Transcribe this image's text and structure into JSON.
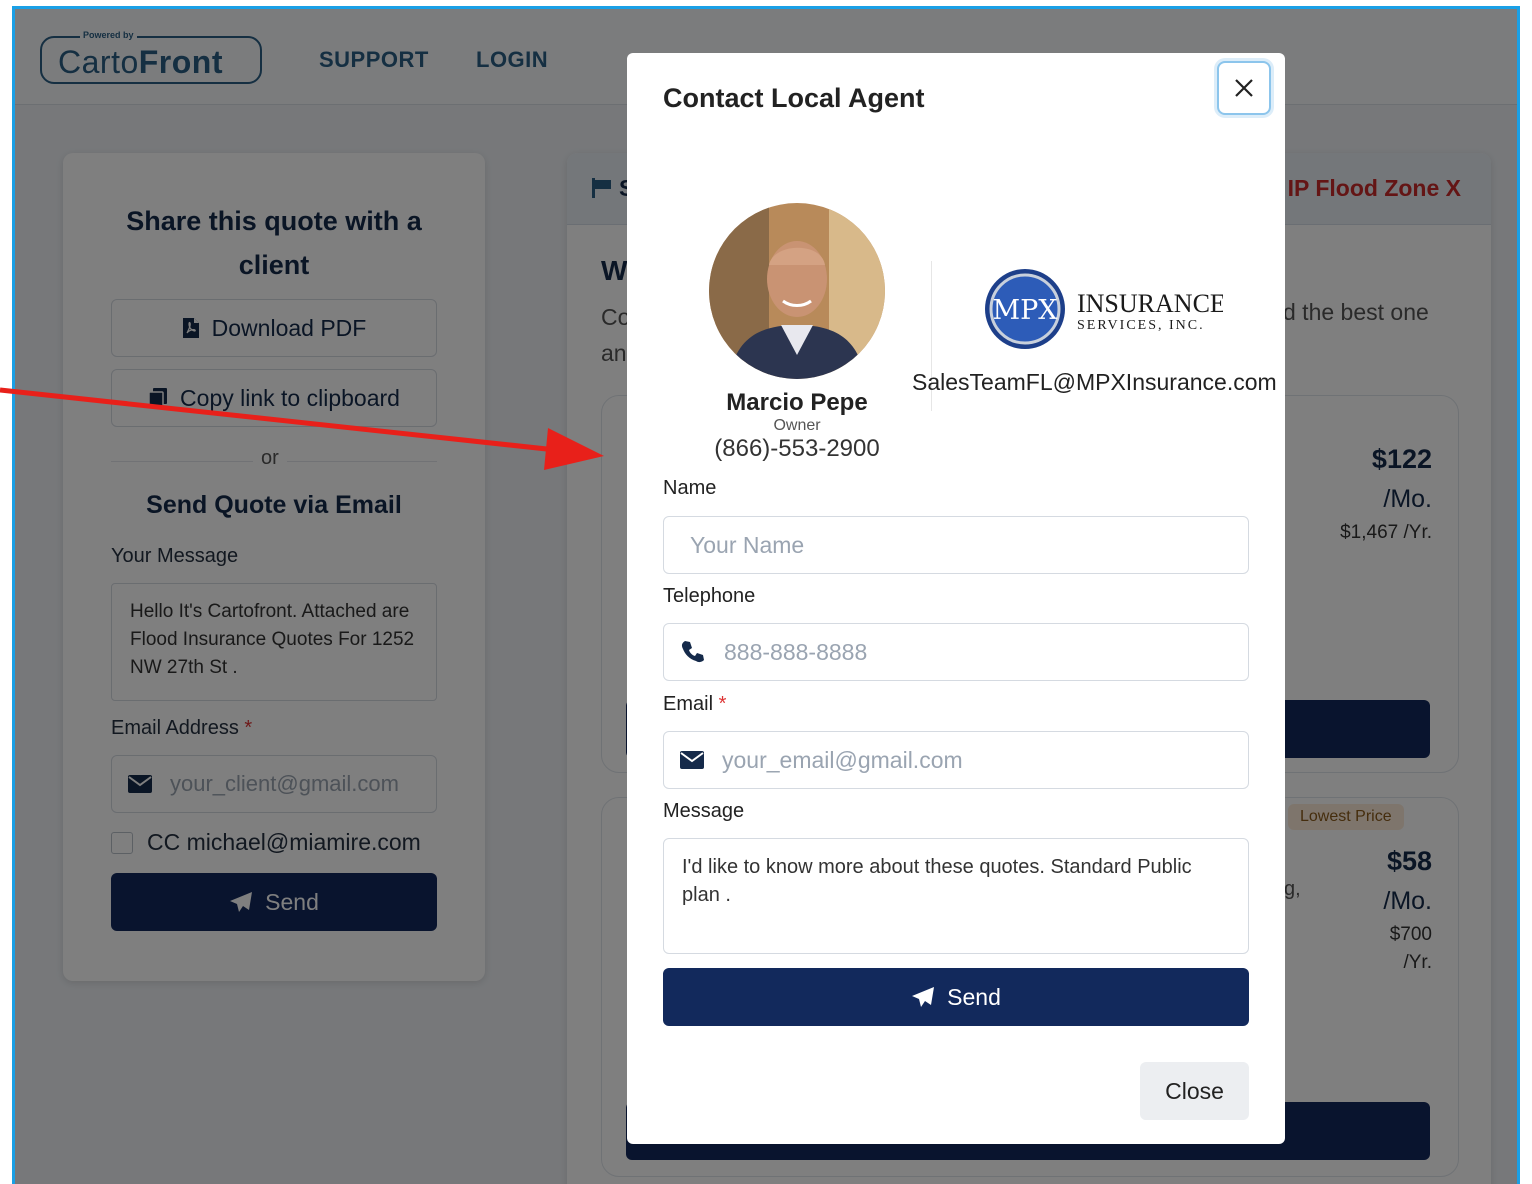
{
  "nav": {
    "brand_powered": "Powered by",
    "brand_name_a": "Carto",
    "brand_name_b": "Front",
    "links": [
      "SUPPORT",
      "LOGIN"
    ]
  },
  "share": {
    "title": "Share this quote with a client",
    "download_pdf": "Download PDF",
    "copy_link": "Copy link to clipboard",
    "or": "or",
    "send_title": "Send Quote via Email",
    "message_label": "Your Message",
    "message_value": "Hello It's Cartofront. Attached are Flood Insurance Quotes For 1252 NW 27th St .",
    "email_label": "Email Address",
    "required_mark": "*",
    "email_placeholder": "your_client@gmail.com",
    "cc_label": "CC michael@miamire.com",
    "send_label": "Send"
  },
  "quotes": {
    "header_left": "S",
    "header_right": "IP Flood Zone X",
    "w": "W",
    "c_line1": "Co",
    "c_line2": "an",
    "best": "d the best one",
    "plan1": {
      "price": "$122",
      "per_mo": "/Mo.",
      "per_yr": "$1,467 /Yr."
    },
    "plan2": {
      "badge": "Lowest Price",
      "price": "$58",
      "per_mo": "/Mo.",
      "per_yr_a": "$700",
      "per_yr_b": "/Yr.",
      "frag": "g,"
    }
  },
  "modal": {
    "title": "Contact Local Agent",
    "agent_name": "Marcio Pepe",
    "agent_role": "Owner",
    "agent_phone": "(866)-553-2900",
    "agent_email": "SalesTeamFL@MPXInsurance.com",
    "logo_mark": "MPX",
    "logo_line1": "INSURANCE",
    "logo_line2": "SERVICES, INC.",
    "name_label": "Name",
    "name_placeholder": "Your Name",
    "phone_label": "Telephone",
    "phone_placeholder": "888-888-8888",
    "email_label": "Email",
    "required_mark": "*",
    "email_placeholder": "your_email@gmail.com",
    "message_label": "Message",
    "message_value": "I'd like to know more about these quotes. Standard Public plan .",
    "send_label": "Send",
    "close_label": "Close"
  },
  "colors": {
    "navy": "#12295c",
    "brand": "#2b5e84",
    "flood_red": "#c92a2a",
    "annotation_arrow": "#e8201a"
  }
}
